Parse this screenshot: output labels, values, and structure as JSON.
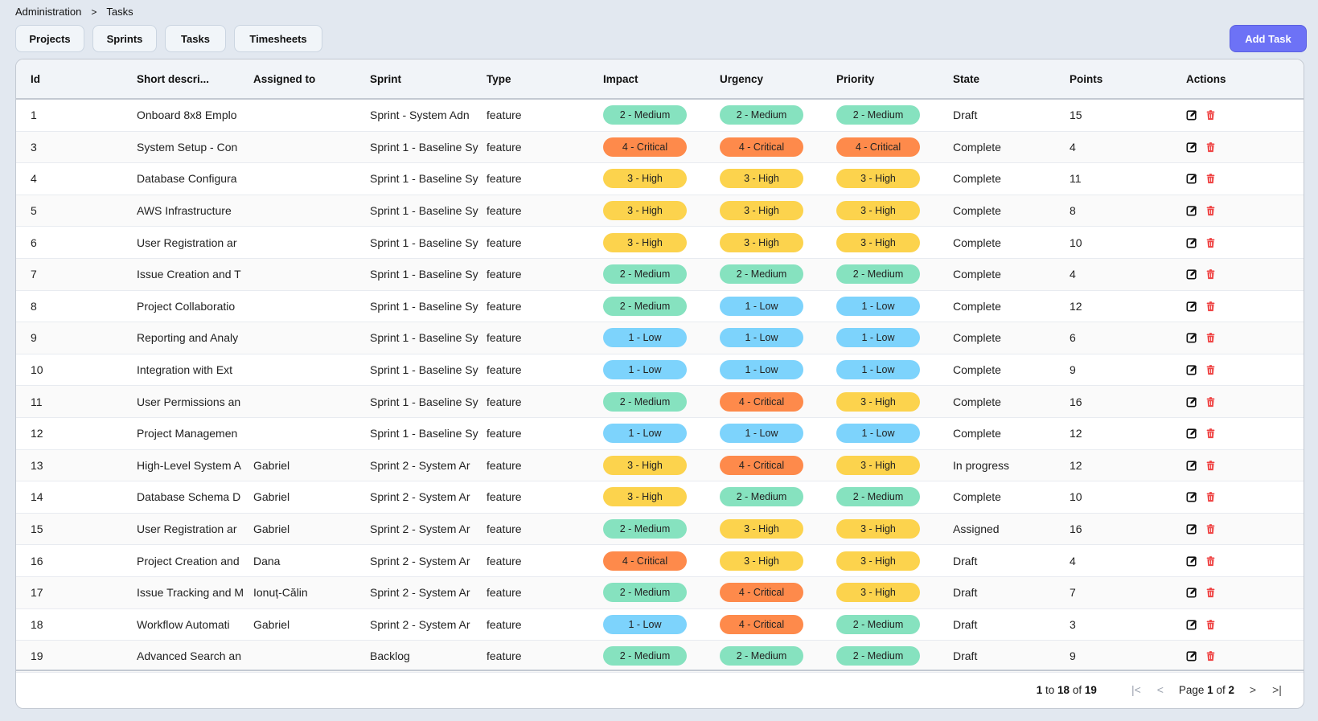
{
  "breadcrumb": {
    "parent": "Administration",
    "separator": ">",
    "current": "Tasks"
  },
  "nav_tabs": [
    "Projects",
    "Sprints",
    "Tasks",
    "Timesheets"
  ],
  "add_button": "Add Task",
  "columns": [
    "Id",
    "Short descri...",
    "Assigned to",
    "Sprint",
    "Type",
    "Impact",
    "Urgency",
    "Priority",
    "State",
    "Points",
    "Actions"
  ],
  "level_colors": {
    "1": "#7dd3fc",
    "2": "#86e2bf",
    "3": "#fcd34d",
    "4": "#fe8a4b"
  },
  "rows": [
    {
      "id": "1",
      "desc": "Onboard 8x8 Emplo",
      "assigned": "",
      "sprint": "Sprint - System Adn",
      "type": "feature",
      "impact": "2 - Medium",
      "urgency": "2 - Medium",
      "priority": "2 - Medium",
      "state": "Draft",
      "points": "15"
    },
    {
      "id": "3",
      "desc": "System Setup - Con",
      "assigned": "",
      "sprint": "Sprint 1 - Baseline Sy",
      "type": "feature",
      "impact": "4 - Critical",
      "urgency": "4 - Critical",
      "priority": "4 - Critical",
      "state": "Complete",
      "points": "4"
    },
    {
      "id": "4",
      "desc": "Database Configura",
      "assigned": "",
      "sprint": "Sprint 1 - Baseline Sy",
      "type": "feature",
      "impact": "3 - High",
      "urgency": "3 - High",
      "priority": "3 - High",
      "state": "Complete",
      "points": "11"
    },
    {
      "id": "5",
      "desc": "AWS Infrastructure",
      "assigned": "",
      "sprint": "Sprint 1 - Baseline Sy",
      "type": "feature",
      "impact": "3 - High",
      "urgency": "3 - High",
      "priority": "3 - High",
      "state": "Complete",
      "points": "8"
    },
    {
      "id": "6",
      "desc": "User Registration ar",
      "assigned": "",
      "sprint": "Sprint 1 - Baseline Sy",
      "type": "feature",
      "impact": "3 - High",
      "urgency": "3 - High",
      "priority": "3 - High",
      "state": "Complete",
      "points": "10"
    },
    {
      "id": "7",
      "desc": "Issue Creation and T",
      "assigned": "",
      "sprint": "Sprint 1 - Baseline Sy",
      "type": "feature",
      "impact": "2 - Medium",
      "urgency": "2 - Medium",
      "priority": "2 - Medium",
      "state": "Complete",
      "points": "4"
    },
    {
      "id": "8",
      "desc": "Project Collaboratio",
      "assigned": "",
      "sprint": "Sprint 1 - Baseline Sy",
      "type": "feature",
      "impact": "2 - Medium",
      "urgency": "1 - Low",
      "priority": "1 - Low",
      "state": "Complete",
      "points": "12"
    },
    {
      "id": "9",
      "desc": "Reporting and Analy",
      "assigned": "",
      "sprint": "Sprint 1 - Baseline Sy",
      "type": "feature",
      "impact": "1 - Low",
      "urgency": "1 - Low",
      "priority": "1 - Low",
      "state": "Complete",
      "points": "6"
    },
    {
      "id": "10",
      "desc": "Integration with Ext",
      "assigned": "",
      "sprint": "Sprint 1 - Baseline Sy",
      "type": "feature",
      "impact": "1 - Low",
      "urgency": "1 - Low",
      "priority": "1 - Low",
      "state": "Complete",
      "points": "9"
    },
    {
      "id": "11",
      "desc": "User Permissions an",
      "assigned": "",
      "sprint": "Sprint 1 - Baseline Sy",
      "type": "feature",
      "impact": "2 - Medium",
      "urgency": "4 - Critical",
      "priority": "3 - High",
      "state": "Complete",
      "points": "16"
    },
    {
      "id": "12",
      "desc": "Project Managemen",
      "assigned": "",
      "sprint": "Sprint 1 - Baseline Sy",
      "type": "feature",
      "impact": "1 - Low",
      "urgency": "1 - Low",
      "priority": "1 - Low",
      "state": "Complete",
      "points": "12"
    },
    {
      "id": "13",
      "desc": "High-Level System A",
      "assigned": "Gabriel",
      "sprint": "Sprint 2 - System Ar",
      "type": "feature",
      "impact": "3 - High",
      "urgency": "4 - Critical",
      "priority": "3 - High",
      "state": "In progress",
      "points": "12"
    },
    {
      "id": "14",
      "desc": "Database Schema D",
      "assigned": "Gabriel",
      "sprint": "Sprint 2 - System Ar",
      "type": "feature",
      "impact": "3 - High",
      "urgency": "2 - Medium",
      "priority": "2 - Medium",
      "state": "Complete",
      "points": "10"
    },
    {
      "id": "15",
      "desc": "User Registration ar",
      "assigned": "Gabriel",
      "sprint": "Sprint 2 - System Ar",
      "type": "feature",
      "impact": "2 - Medium",
      "urgency": "3 - High",
      "priority": "3 - High",
      "state": "Assigned",
      "points": "16"
    },
    {
      "id": "16",
      "desc": "Project Creation and",
      "assigned": "Dana",
      "sprint": "Sprint 2 - System Ar",
      "type": "feature",
      "impact": "4 - Critical",
      "urgency": "3 - High",
      "priority": "3 - High",
      "state": "Draft",
      "points": "4"
    },
    {
      "id": "17",
      "desc": "Issue Tracking and M",
      "assigned": "Ionuț-Călin",
      "sprint": "Sprint 2 - System Ar",
      "type": "feature",
      "impact": "2 - Medium",
      "urgency": "4 - Critical",
      "priority": "3 - High",
      "state": "Draft",
      "points": "7"
    },
    {
      "id": "18",
      "desc": "Workflow Automati",
      "assigned": "Gabriel",
      "sprint": "Sprint 2 - System Ar",
      "type": "feature",
      "impact": "1 - Low",
      "urgency": "4 - Critical",
      "priority": "2 - Medium",
      "state": "Draft",
      "points": "3"
    },
    {
      "id": "19",
      "desc": "Advanced Search an",
      "assigned": "",
      "sprint": "Backlog",
      "type": "feature",
      "impact": "2 - Medium",
      "urgency": "2 - Medium",
      "priority": "2 - Medium",
      "state": "Draft",
      "points": "9"
    }
  ],
  "actions": {
    "edit_icon": "edit-icon",
    "delete_icon": "trash-icon",
    "delete_color": "#ef4444"
  },
  "pagination": {
    "from": "1",
    "to_label": "to",
    "to": "18",
    "of_label": "of",
    "total": "19",
    "page_label": "Page",
    "page": "1",
    "page_of_label": "of",
    "pages": "2",
    "first": "|<",
    "prev": "<",
    "next": ">",
    "last": ">|"
  },
  "accent_color": "#6d72f6"
}
